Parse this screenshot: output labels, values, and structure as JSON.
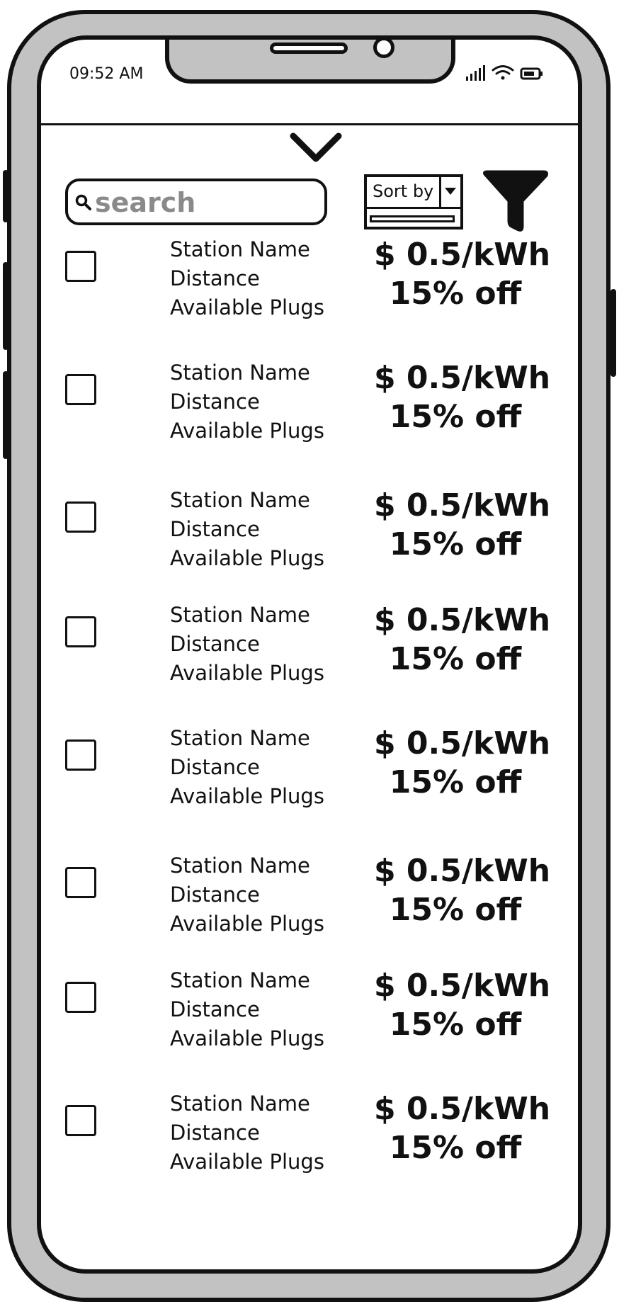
{
  "status_bar": {
    "time": "09:52 AM"
  },
  "search": {
    "placeholder": "search"
  },
  "sort": {
    "label": "Sort by"
  },
  "stations": [
    {
      "name": "Station Name",
      "distance": "Distance",
      "plugs": "Available Plugs",
      "price": "$ 0.5/kWh",
      "discount": "15% off"
    },
    {
      "name": "Station Name",
      "distance": "Distance",
      "plugs": "Available Plugs",
      "price": "$ 0.5/kWh",
      "discount": "15% off"
    },
    {
      "name": "Station Name",
      "distance": "Distance",
      "plugs": "Available Plugs",
      "price": "$ 0.5/kWh",
      "discount": "15% off"
    },
    {
      "name": "Station Name",
      "distance": "Distance",
      "plugs": "Available Plugs",
      "price": "$ 0.5/kWh",
      "discount": "15% off"
    },
    {
      "name": "Station Name",
      "distance": "Distance",
      "plugs": "Available Plugs",
      "price": "$ 0.5/kWh",
      "discount": "15% off"
    },
    {
      "name": "Station Name",
      "distance": "Distance",
      "plugs": "Available Plugs",
      "price": "$ 0.5/kWh",
      "discount": "15% off"
    },
    {
      "name": "Station Name",
      "distance": "Distance",
      "plugs": "Available Plugs",
      "price": "$ 0.5/kWh",
      "discount": "15% off"
    },
    {
      "name": "Station Name",
      "distance": "Distance",
      "plugs": "Available Plugs",
      "price": "$ 0.5/kWh",
      "discount": "15% off"
    }
  ],
  "icons": {
    "chevron": "chevron-down-icon",
    "search": "search-icon",
    "filter": "filter-icon",
    "signal": "signal-icon",
    "wifi": "wifi-icon",
    "battery": "battery-icon"
  },
  "colors": {
    "frame": "#c2c2c2",
    "ink": "#111111",
    "placeholder": "#8a8a8a"
  }
}
